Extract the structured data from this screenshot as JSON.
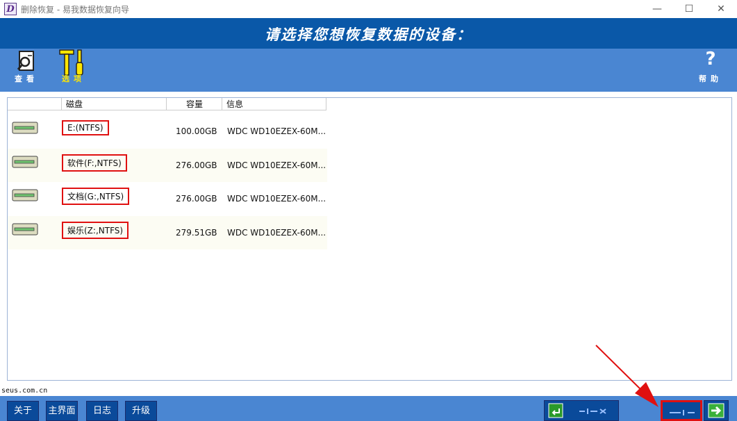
{
  "window": {
    "icon_letter": "D",
    "title": "删除恢复 - 易我数据恢复向导",
    "controls": {
      "minimize": "—",
      "maximize": "☐",
      "close": "✕"
    }
  },
  "banner": {
    "title": "请选择您想恢复数据的设备："
  },
  "toolbar": {
    "view": {
      "label": "查看",
      "icon": "magnifier-document-icon"
    },
    "options": {
      "label": "选项",
      "icon": "tools-icon"
    },
    "help": {
      "glyph": "?",
      "label": "帮助"
    }
  },
  "list": {
    "headers": [
      "磁盘",
      "容量",
      "信息"
    ],
    "rows": [
      {
        "name": "E:(NTFS)",
        "capacity": "100.00GB",
        "info": "WDC WD10EZEX-60M..."
      },
      {
        "name": "软件(F:,NTFS)",
        "capacity": "276.00GB",
        "info": "WDC WD10EZEX-60M..."
      },
      {
        "name": "文档(G:,NTFS)",
        "capacity": "276.00GB",
        "info": "WDC WD10EZEX-60M..."
      },
      {
        "name": "娱乐(Z:,NTFS)",
        "capacity": "279.51GB",
        "info": "WDC WD10EZEX-60M..."
      }
    ]
  },
  "footer": {
    "url": "seus.com.cn",
    "buttons": [
      "关于",
      "主界面",
      "日志",
      "升级"
    ]
  },
  "colors": {
    "banner": "#0a58a8",
    "toolbar": "#4a86d2",
    "highlight": "#e01010",
    "options_icon": "#ffe600"
  }
}
